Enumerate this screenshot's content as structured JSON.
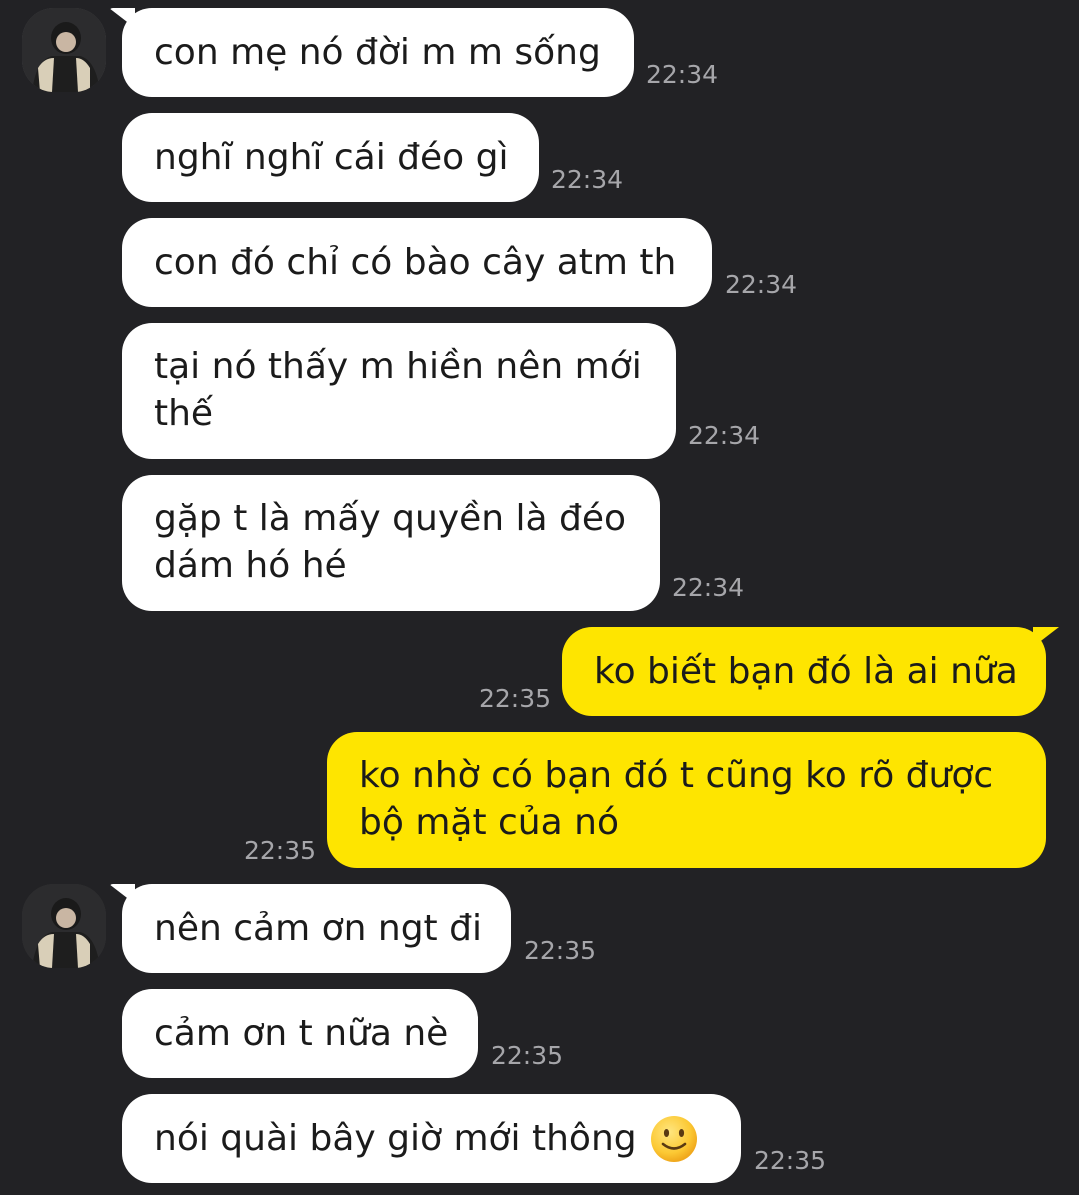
{
  "messages": [
    {
      "side": "in",
      "text": "con mẹ nó đời m m sống",
      "time": "22:34"
    },
    {
      "side": "in",
      "text": "nghĩ nghĩ cái đéo gì",
      "time": "22:34"
    },
    {
      "side": "in",
      "text": "con đó chỉ có bào cây atm th",
      "time": "22:34"
    },
    {
      "side": "in",
      "line1": "tại nó thấy m hiền nên mới",
      "line2": "thế",
      "time": "22:34"
    },
    {
      "side": "in",
      "line1": "gặp t là mấy quyền là đéo",
      "line2": "dám hó hé",
      "time": "22:34"
    },
    {
      "side": "out",
      "text": "ko biết bạn đó là ai nữa",
      "time": "22:35"
    },
    {
      "side": "out",
      "line1": "ko nhờ có bạn đó t cũng ko rõ được",
      "line2": "bộ mặt của nó",
      "time": "22:35"
    },
    {
      "side": "in",
      "text": "nên cảm ơn ngt đi",
      "time": "22:35"
    },
    {
      "side": "in",
      "text": "cảm ơn t nữa nè",
      "time": "22:35"
    },
    {
      "side": "in",
      "text": "nói quài bây giờ mới thông",
      "emoji": "slightly-smiling-face-icon",
      "time": "22:35"
    }
  ],
  "colors": {
    "background": "#222225",
    "incoming_bubble": "#ffffff",
    "outgoing_bubble": "#fee500",
    "timestamp": "#a6a6aa"
  }
}
